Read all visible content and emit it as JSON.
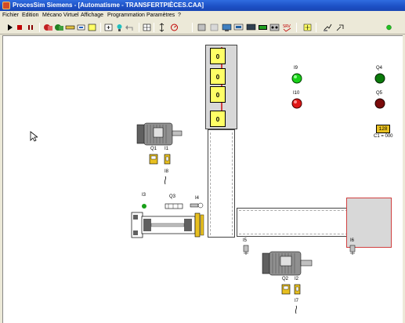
{
  "window": {
    "title": "ProcesSim Siemens - [Automatisme - TRANSFERTPIÈCES.CAA]"
  },
  "menu": {
    "items": [
      "Fichier",
      "Edition",
      "Mécano Virtuel",
      "Affichage",
      "Programmation",
      "Paramètres",
      "?"
    ]
  },
  "toolbar": {
    "buttons": [
      "run",
      "stop",
      "pause",
      "components",
      "green-components",
      "sensor",
      "actuator",
      "module",
      "add",
      "input",
      "output",
      "undo",
      "delete",
      "cut",
      "link",
      "measure",
      "view1",
      "view2",
      "plc",
      "display1",
      "display2",
      "display3",
      "counter",
      "timer",
      "analog",
      "pointer",
      "options",
      "status-light"
    ],
    "status_light_color": "#22c022"
  },
  "scene": {
    "counters": [
      {
        "id": "c1",
        "value": "0"
      },
      {
        "id": "c2",
        "value": "0"
      },
      {
        "id": "c3",
        "value": "0"
      },
      {
        "id": "c4",
        "value": "0"
      }
    ],
    "lamps": {
      "I9": {
        "label": "I9",
        "color": "#18d018"
      },
      "I10": {
        "label": "I10",
        "color": "#e01818"
      },
      "Q4": {
        "label": "Q4",
        "color": "#0a7a0a"
      },
      "Q5": {
        "label": "Q5",
        "color": "#7a0a0a"
      }
    },
    "counter_display": {
      "label": "C1 = 000",
      "glyph": "128"
    },
    "labels": {
      "Q1": "Q1",
      "I1": "I1",
      "I8": "I8",
      "I3": "I3",
      "Q3": "Q3",
      "I4": "I4",
      "I5": "I5",
      "I6": "I6",
      "Q2": "Q2",
      "I2": "I2",
      "I7": "I7"
    },
    "colors": {
      "counter_yellow": "#ffff66",
      "conveyor_red": "#d04040",
      "sensor_green": "#18a018"
    }
  }
}
